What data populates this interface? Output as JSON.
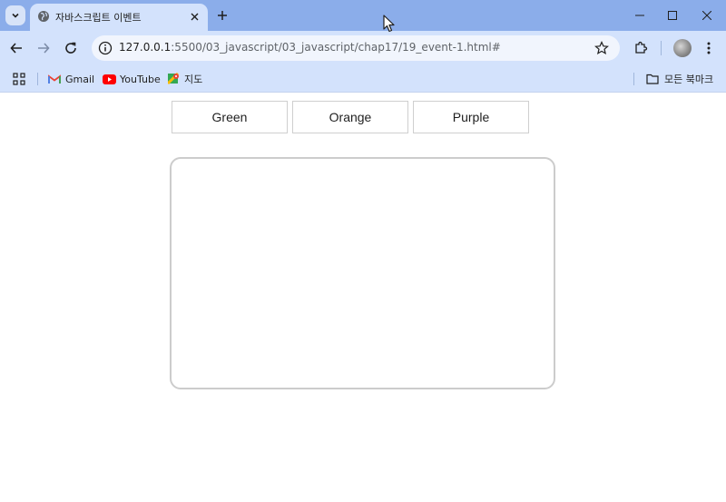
{
  "browser": {
    "tab": {
      "title": "자바스크립트 이벤트"
    },
    "address_bar": {
      "host": "127.0.0.1",
      "path": ":5500/03_javascript/03_javascript/chap17/19_event-1.html#"
    },
    "bookmarks": [
      {
        "label": "Gmail",
        "icon": "gmail-icon"
      },
      {
        "label": "YouTube",
        "icon": "youtube-icon"
      },
      {
        "label": "지도",
        "icon": "maps-icon"
      }
    ],
    "all_bookmarks_label": "모든 북마크"
  },
  "page": {
    "buttons": [
      {
        "label": "Green"
      },
      {
        "label": "Orange"
      },
      {
        "label": "Purple"
      }
    ]
  },
  "colors": {
    "tabstrip": "#8badea",
    "toolbar": "#d3e2fc",
    "box_border": "#cccccc"
  }
}
